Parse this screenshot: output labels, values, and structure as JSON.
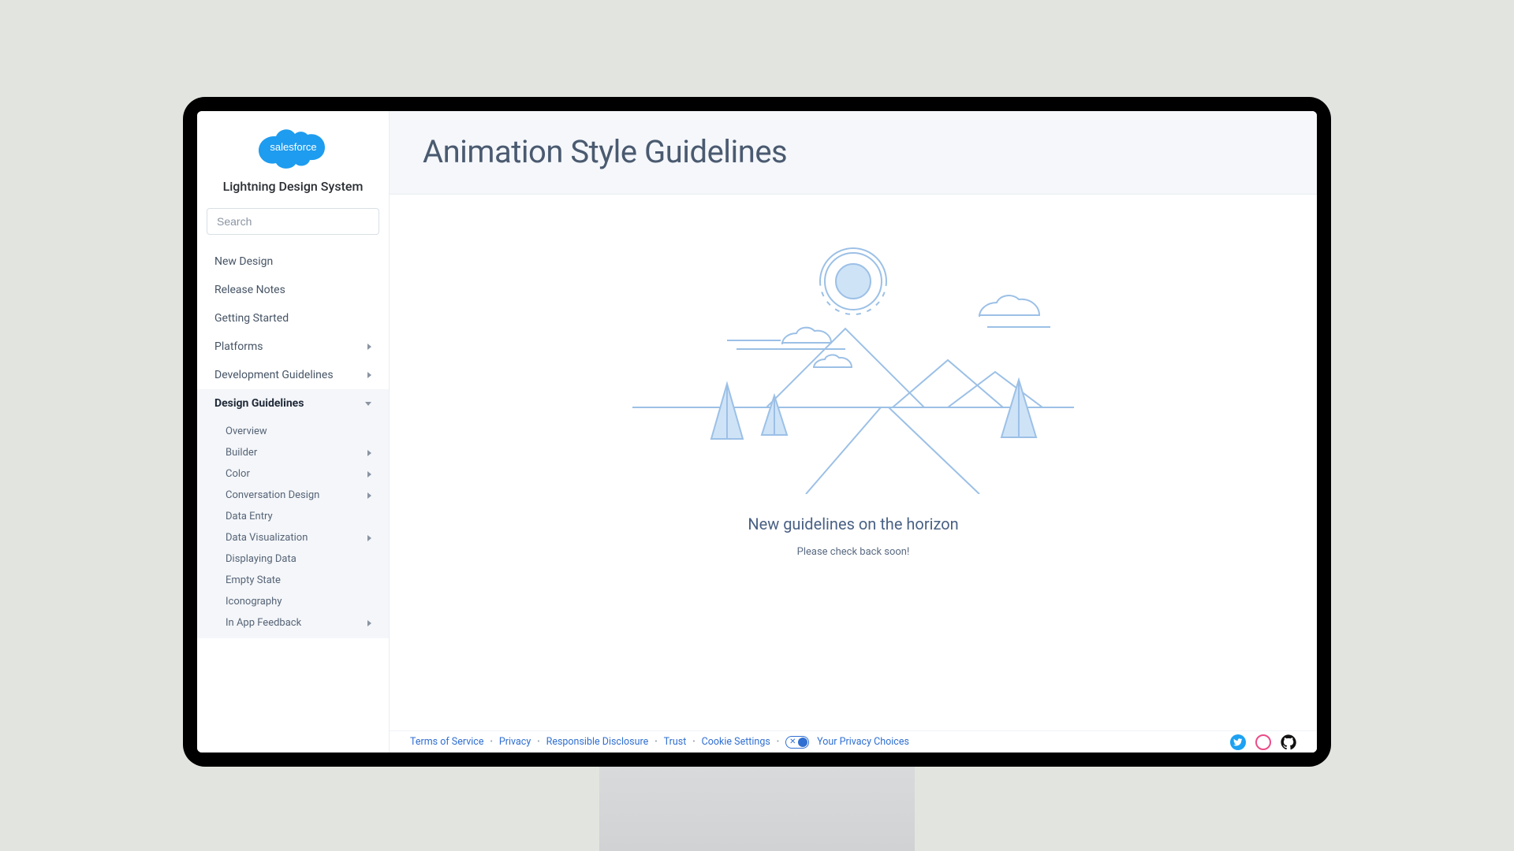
{
  "brand": {
    "name": "salesforce",
    "subtitle": "Lightning Design System"
  },
  "search": {
    "placeholder": "Search"
  },
  "sidebar": {
    "items": [
      {
        "label": "New Design",
        "expandable": false
      },
      {
        "label": "Release Notes",
        "expandable": false
      },
      {
        "label": "Getting Started",
        "expandable": false
      },
      {
        "label": "Platforms",
        "expandable": true
      },
      {
        "label": "Development Guidelines",
        "expandable": true
      },
      {
        "label": "Design Guidelines",
        "expandable": true,
        "active": true
      }
    ],
    "sub": [
      {
        "label": "Overview",
        "expandable": false
      },
      {
        "label": "Builder",
        "expandable": true
      },
      {
        "label": "Color",
        "expandable": true
      },
      {
        "label": "Conversation Design",
        "expandable": true
      },
      {
        "label": "Data Entry",
        "expandable": false
      },
      {
        "label": "Data Visualization",
        "expandable": true
      },
      {
        "label": "Displaying Data",
        "expandable": false
      },
      {
        "label": "Empty State",
        "expandable": false
      },
      {
        "label": "Iconography",
        "expandable": false
      },
      {
        "label": "In App Feedback",
        "expandable": true
      }
    ]
  },
  "page": {
    "title": "Animation Style Guidelines",
    "message_title": "New guidelines on the horizon",
    "message_sub": "Please check back soon!"
  },
  "footer": {
    "links": [
      "Terms of Service",
      "Privacy",
      "Responsible Disclosure",
      "Trust",
      "Cookie Settings"
    ],
    "privacy_choices": "Your Privacy Choices"
  },
  "colors": {
    "accent": "#2f6fd1",
    "illus": "#bcd6f2",
    "illus_line": "#9cc0e6"
  }
}
